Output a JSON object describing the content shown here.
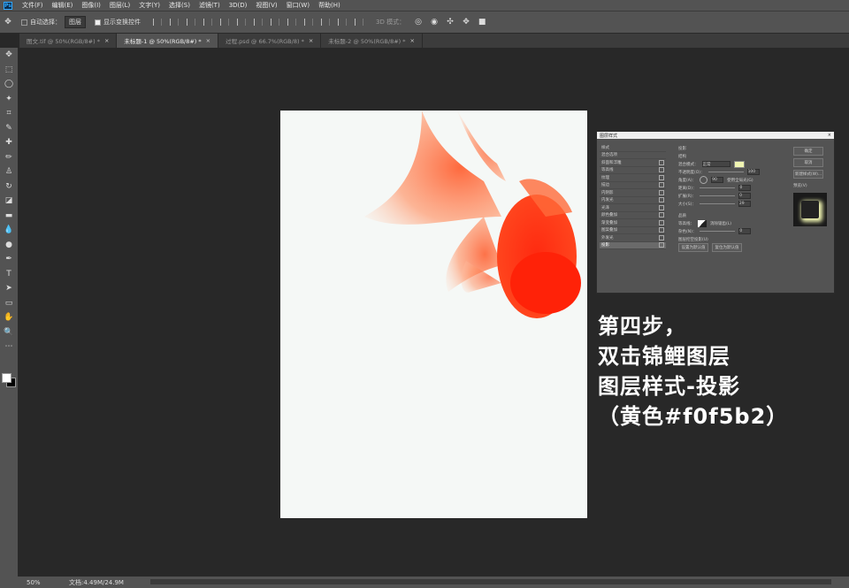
{
  "menubar": {
    "logo": "Ps",
    "items": [
      "文件(F)",
      "编辑(E)",
      "图像(I)",
      "图层(L)",
      "文字(Y)",
      "选择(S)",
      "滤镜(T)",
      "3D(D)",
      "视图(V)",
      "窗口(W)",
      "帮助(H)"
    ]
  },
  "options": {
    "auto_select_label": "自动选择：",
    "auto_select_value": "图层",
    "show_transform_label": "显示变换控件",
    "mode3d_label": "3D 模式："
  },
  "tabs": [
    {
      "label": "图文.tif @ 50%(RGB/8#) *",
      "active": false
    },
    {
      "label": "未标题-1 @ 50%(RGB/8#) *",
      "active": true
    },
    {
      "label": "过程.psd @ 66.7%(RGB/8) *",
      "active": false
    },
    {
      "label": "未标题-2 @ 50%(RGB/8#) *",
      "active": false
    }
  ],
  "tools": [
    "move-icon",
    "marquee-icon",
    "lasso-icon",
    "magic-wand-icon",
    "crop-icon",
    "eyedropper-icon",
    "healing-icon",
    "brush-icon",
    "stamp-icon",
    "history-brush-icon",
    "eraser-icon",
    "gradient-icon",
    "blur-icon",
    "dodge-icon",
    "pen-icon",
    "type-icon",
    "path-select-icon",
    "rectangle-icon",
    "hand-icon",
    "zoom-icon",
    "more-icon"
  ],
  "tool_glyphs": [
    "✥",
    "⬚",
    "◯",
    "✦",
    "⌗",
    "✎",
    "✚",
    "✏",
    "♙",
    "↻",
    "◪",
    "▬",
    "💧",
    "●",
    "✒",
    "T",
    "➤",
    "▭",
    "✋",
    "🔍",
    "⋯"
  ],
  "dialog": {
    "title": "图层样式",
    "close": "×",
    "styles": [
      "样式",
      "混合选项",
      "斜面和浮雕",
      "等高线",
      "纹理",
      "描边",
      "内阴影",
      "内发光",
      "光泽",
      "颜色叠加",
      "渐变叠加",
      "图案叠加",
      "外发光",
      "投影"
    ],
    "selected_style": "投影",
    "section_title": "投影",
    "structure": "结构",
    "blend_mode_label": "混合模式：",
    "blend_mode_value": "正常",
    "opacity_label": "不透明度(O)：",
    "opacity_value": "100",
    "angle_label": "角度(A)：",
    "angle_value": "90",
    "global_light": "使用全局光(G)",
    "distance_label": "距离(D)：",
    "distance_value": "0",
    "spread_label": "扩展(R)：",
    "spread_value": "0",
    "size_label": "大小(S)：",
    "size_value": "29",
    "quality": "品质",
    "contour_label": "等高线：",
    "antialias": "消除锯齿(L)",
    "noise_label": "杂色(N)：",
    "noise_value": "0",
    "knockout": "图层挖空投影(U)",
    "default_btn": "设置为默认值",
    "reset_btn": "复位为默认值",
    "ok_btn": "确定",
    "cancel_btn": "取消",
    "new_style_btn": "新建样式(W)...",
    "preview_label": "预览(V)",
    "shadow_color": "#f0f5b2"
  },
  "caption": {
    "line1": "第四步，",
    "line2": "双击锦鲤图层",
    "line3": "图层样式-投影",
    "line4": "（黄色#f0f5b2）"
  },
  "status": {
    "zoom": "50%",
    "doc": "文档:4.49M/24.9M"
  }
}
